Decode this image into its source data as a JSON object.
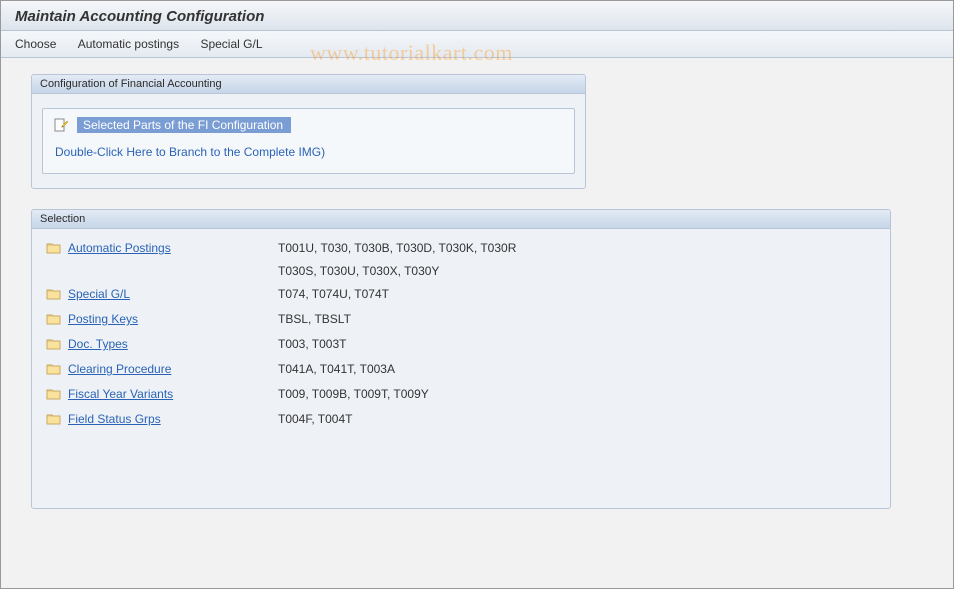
{
  "header": {
    "title": "Maintain Accounting Configuration"
  },
  "toolbar": {
    "choose": "Choose",
    "automatic_postings": "Automatic postings",
    "special_gl": "Special G/L"
  },
  "watermark": "www.tutorialkart.com",
  "config_box": {
    "title": "Configuration of Financial Accounting",
    "selected_parts_label": "Selected Parts of the FI Configuration",
    "branch_link": "Double-Click Here to Branch to the Complete IMG)"
  },
  "selection_box": {
    "title": "Selection",
    "items": [
      {
        "label": "Automatic Postings",
        "tables": "T001U, T030,  T030B, T030D, T030K, T030R",
        "tables_cont": "T030S, T030U, T030X, T030Y"
      },
      {
        "label": "Special G/L",
        "tables": "T074,  T074U, T074T"
      },
      {
        "label": "Posting Keys",
        "tables": "TBSL,  TBSLT"
      },
      {
        "label": "Doc. Types",
        "tables": "T003,  T003T"
      },
      {
        "label": "Clearing Procedure",
        "tables": "T041A, T041T, T003A"
      },
      {
        "label": "Fiscal Year Variants",
        "tables": "T009,  T009B, T009T, T009Y"
      },
      {
        "label": "Field Status Grps",
        "tables": "T004F, T004T"
      }
    ]
  }
}
